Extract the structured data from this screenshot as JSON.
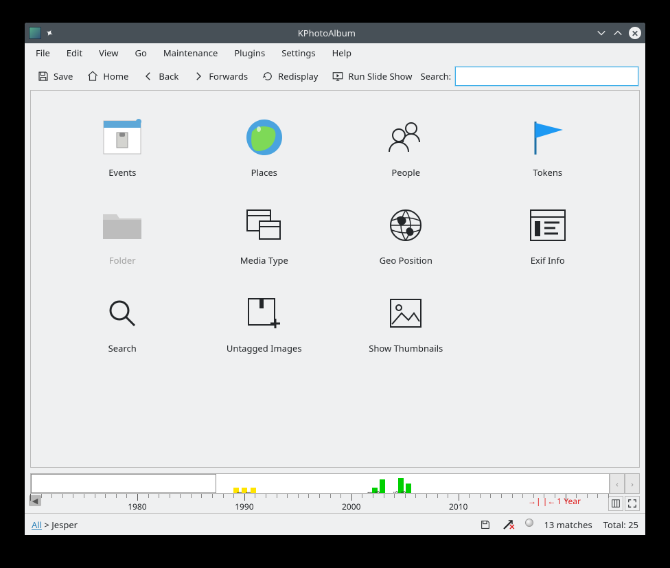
{
  "window": {
    "title": "KPhotoAlbum"
  },
  "menu": {
    "items": [
      "File",
      "Edit",
      "View",
      "Go",
      "Maintenance",
      "Plugins",
      "Settings",
      "Help"
    ]
  },
  "toolbar": {
    "save": "Save",
    "home": "Home",
    "back": "Back",
    "forwards": "Forwards",
    "redisplay": "Redisplay",
    "slideshow": "Run Slide Show",
    "search_label": "Search:",
    "search_value": ""
  },
  "categories": [
    {
      "label": "Events",
      "icon": "events-icon"
    },
    {
      "label": "Places",
      "icon": "globe-icon"
    },
    {
      "label": "People",
      "icon": "people-icon"
    },
    {
      "label": "Tokens",
      "icon": "flag-icon"
    },
    {
      "label": "Folder",
      "icon": "folder-icon",
      "disabled": true
    },
    {
      "label": "Media Type",
      "icon": "media-type-icon"
    },
    {
      "label": "Geo Position",
      "icon": "globe-wire-icon"
    },
    {
      "label": "Exif Info",
      "icon": "exif-icon"
    },
    {
      "label": "Search",
      "icon": "search-icon"
    },
    {
      "label": "Untagged Images",
      "icon": "untagged-icon"
    },
    {
      "label": "Show Thumbnails",
      "icon": "thumbnails-icon"
    }
  ],
  "timeline": {
    "years": [
      "1980",
      "1990",
      "2000",
      "2010"
    ],
    "range_label": "1 Year",
    "bars": [
      {
        "pos_pct": 35.0,
        "h": 8,
        "count": "",
        "color": "yellow"
      },
      {
        "pos_pct": 36.5,
        "h": 8,
        "count": "1",
        "color": "yellow"
      },
      {
        "pos_pct": 38.0,
        "h": 8,
        "count": "1",
        "color": "yellow"
      },
      {
        "pos_pct": 59.0,
        "h": 8,
        "count": "1",
        "color": "green"
      },
      {
        "pos_pct": 60.3,
        "h": 20,
        "count": "3",
        "color": "green"
      },
      {
        "pos_pct": 63.5,
        "h": 22,
        "count": "5",
        "color": "green"
      },
      {
        "pos_pct": 64.8,
        "h": 14,
        "count": "3",
        "color": "green"
      }
    ]
  },
  "status": {
    "breadcrumb_root": "All",
    "breadcrumb_sep": " > ",
    "breadcrumb_current": "Jesper",
    "matches": "13 matches",
    "total": "Total: 25"
  }
}
